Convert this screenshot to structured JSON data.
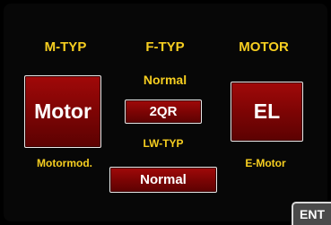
{
  "headers": {
    "m_typ": "M-TYP",
    "f_typ": "F-TYP",
    "motor": "MOTOR"
  },
  "f_typ_value": "Normal",
  "lw_typ_label": "LW-TYP",
  "buttons": {
    "motor": "Motor",
    "f_typ": "2QR",
    "el": "EL",
    "lw_typ": "Normal",
    "ent": "ENT"
  },
  "captions": {
    "motormod": "Motormod.",
    "e_motor": "E-Motor"
  },
  "colors": {
    "background": "#000000",
    "label_yellow": "#f6ce20",
    "button_red": "#8b0606",
    "button_border": "#e9e9e9",
    "ent_gray": "#4a4a4a"
  }
}
